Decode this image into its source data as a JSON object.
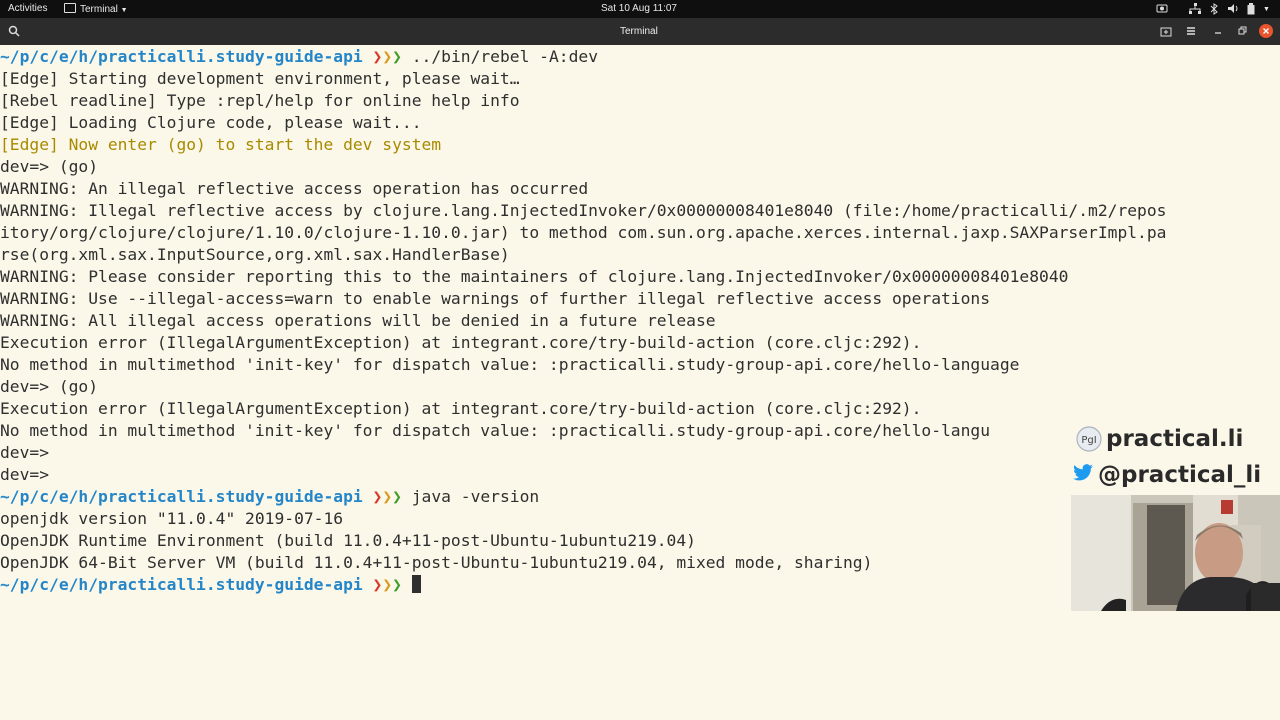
{
  "system_bar": {
    "activities": "Activities",
    "app_menu": "Terminal",
    "clock": "Sat 10 Aug  11:07"
  },
  "window": {
    "title": "Terminal"
  },
  "prompt_path": "~/p/c/e/h/practicalli.study-guide-api",
  "lines": [
    {
      "type": "prompt",
      "cmd": "../bin/rebel -A:dev"
    },
    {
      "type": "text",
      "text": "[Edge] Starting development environment, please wait…"
    },
    {
      "type": "text",
      "text": "[Rebel readline] Type :repl/help for online help info"
    },
    {
      "type": "text",
      "text": "[Edge] Loading Clojure code, please wait..."
    },
    {
      "type": "yellow",
      "text": "[Edge] Now enter (go) to start the dev system"
    },
    {
      "type": "text",
      "text": "dev=> (go)"
    },
    {
      "type": "text",
      "text": "WARNING: An illegal reflective access operation has occurred"
    },
    {
      "type": "text",
      "text": "WARNING: Illegal reflective access by clojure.lang.InjectedInvoker/0x00000008401e8040 (file:/home/practicalli/.m2/repos"
    },
    {
      "type": "text",
      "text": "itory/org/clojure/clojure/1.10.0/clojure-1.10.0.jar) to method com.sun.org.apache.xerces.internal.jaxp.SAXParserImpl.pa"
    },
    {
      "type": "text",
      "text": "rse(org.xml.sax.InputSource,org.xml.sax.HandlerBase)"
    },
    {
      "type": "text",
      "text": "WARNING: Please consider reporting this to the maintainers of clojure.lang.InjectedInvoker/0x00000008401e8040"
    },
    {
      "type": "text",
      "text": "WARNING: Use --illegal-access=warn to enable warnings of further illegal reflective access operations"
    },
    {
      "type": "text",
      "text": "WARNING: All illegal access operations will be denied in a future release"
    },
    {
      "type": "text",
      "text": "Execution error (IllegalArgumentException) at integrant.core/try-build-action (core.cljc:292)."
    },
    {
      "type": "text",
      "text": "No method in multimethod 'init-key' for dispatch value: :practicalli.study-group-api.core/hello-language"
    },
    {
      "type": "text",
      "text": "dev=> (go)"
    },
    {
      "type": "text",
      "text": "Execution error (IllegalArgumentException) at integrant.core/try-build-action (core.cljc:292)."
    },
    {
      "type": "text",
      "text": "No method in multimethod 'init-key' for dispatch value: :practicalli.study-group-api.core/hello-langu"
    },
    {
      "type": "text",
      "text": "dev=>"
    },
    {
      "type": "text",
      "text": "dev=>"
    },
    {
      "type": "prompt",
      "cmd": "java -version"
    },
    {
      "type": "text",
      "text": "openjdk version \"11.0.4\" 2019-07-16"
    },
    {
      "type": "text",
      "text": "OpenJDK Runtime Environment (build 11.0.4+11-post-Ubuntu-1ubuntu219.04)"
    },
    {
      "type": "text",
      "text": "OpenJDK 64-Bit Server VM (build 11.0.4+11-post-Ubuntu-1ubuntu219.04, mixed mode, sharing)"
    },
    {
      "type": "prompt",
      "cmd": "",
      "cursor": true
    }
  ],
  "overlay": {
    "brand": "practical.li",
    "logo_text": "PgI",
    "handle": "@practical_li"
  },
  "colors": {
    "background": "#fbf8ea",
    "path": "#2486c8",
    "warning_yellow": "#a88a00"
  }
}
